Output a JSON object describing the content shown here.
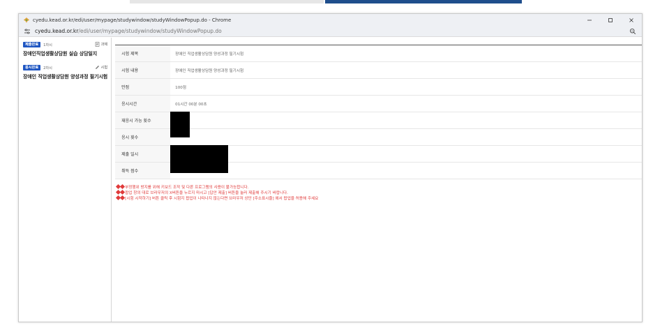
{
  "window": {
    "title": "cyedu.kead.or.kr/edi/user/mypage/studywindow/studyWindowPopup.do - Chrome"
  },
  "address_bar": {
    "host": "cyedu.kead.or.kr",
    "path": "/edi/user/mypage/studywindow/studyWindowPopup.do"
  },
  "sidebar": {
    "items": [
      {
        "badge": "제출완료",
        "count": "1차시",
        "type": "과제",
        "type_icon": "document-icon",
        "title": "장애인직업생활상담원 실습 상담일지"
      },
      {
        "badge": "응시완료",
        "count": "2차시",
        "type": "시험",
        "type_icon": "pencil-icon",
        "title": "장애인 직업생활상담원 양성과정 필기시험"
      }
    ]
  },
  "exam_info": {
    "rows": [
      {
        "label": "시험 제목",
        "value": "장애인 직업생활상담원 양성과정 필기시험"
      },
      {
        "label": "시험 내용",
        "value": "장애인 직업생활상담원 양성과정 필기시험"
      },
      {
        "label": "만점",
        "value": "100점"
      },
      {
        "label": "응시시간",
        "value": "01시간 00분 00초"
      },
      {
        "label": "재응시 가능 횟수",
        "value": ""
      },
      {
        "label": "응시 횟수",
        "value": ""
      },
      {
        "label": "제출 일시",
        "value": ""
      },
      {
        "label": "취득 점수",
        "value": ""
      }
    ]
  },
  "notices": [
    "부정행위 방지를 위해 키보드 조작 및 다른 프로그램의 사용이 불가능합니다.",
    "팝업 창의 대로 브라우저의 X버튼을 누르지 마시고 [답안 제출] 버튼을 눌러 제출해 주시기 바랍니다.",
    "[시험 시작하기] 버튼 클릭 후 시험지 팝업이 나타나지 않는다면 브라우저 상단 [주소표시줄] 에서 팝업을 허용해 주세요"
  ],
  "colors": {
    "accent_blue": "#1f56c2",
    "notice_red": "#e03a3a",
    "redaction": "#000000"
  }
}
